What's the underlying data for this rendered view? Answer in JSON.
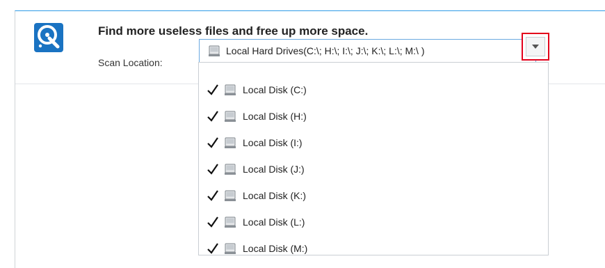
{
  "header": {
    "headline": "Find more useless files and free up more space.",
    "scan_location_label": "Scan Location:"
  },
  "scan_location": {
    "selected_value": "Local Hard Drives(C:\\; H:\\; I:\\; J:\\; K:\\; L:\\; M:\\ )"
  },
  "dropdown": {
    "items": [
      {
        "label": "Local Disk (C:)",
        "checked": true
      },
      {
        "label": "Local Disk (H:)",
        "checked": true
      },
      {
        "label": "Local Disk (I:)",
        "checked": true
      },
      {
        "label": "Local Disk (J:)",
        "checked": true
      },
      {
        "label": "Local Disk (K:)",
        "checked": true
      },
      {
        "label": "Local Disk (L:)",
        "checked": true
      },
      {
        "label": "Local Disk (M:)",
        "checked": true
      }
    ]
  },
  "icons": {
    "app": "disk-cleanup-app-icon",
    "drive": "hard-drive-icon",
    "check": "check-icon",
    "dropdown": "chevron-down-icon"
  },
  "colors": {
    "accent": "#1a73c2",
    "highlight": "#e3001b",
    "combo_border": "#6aa9e0"
  }
}
